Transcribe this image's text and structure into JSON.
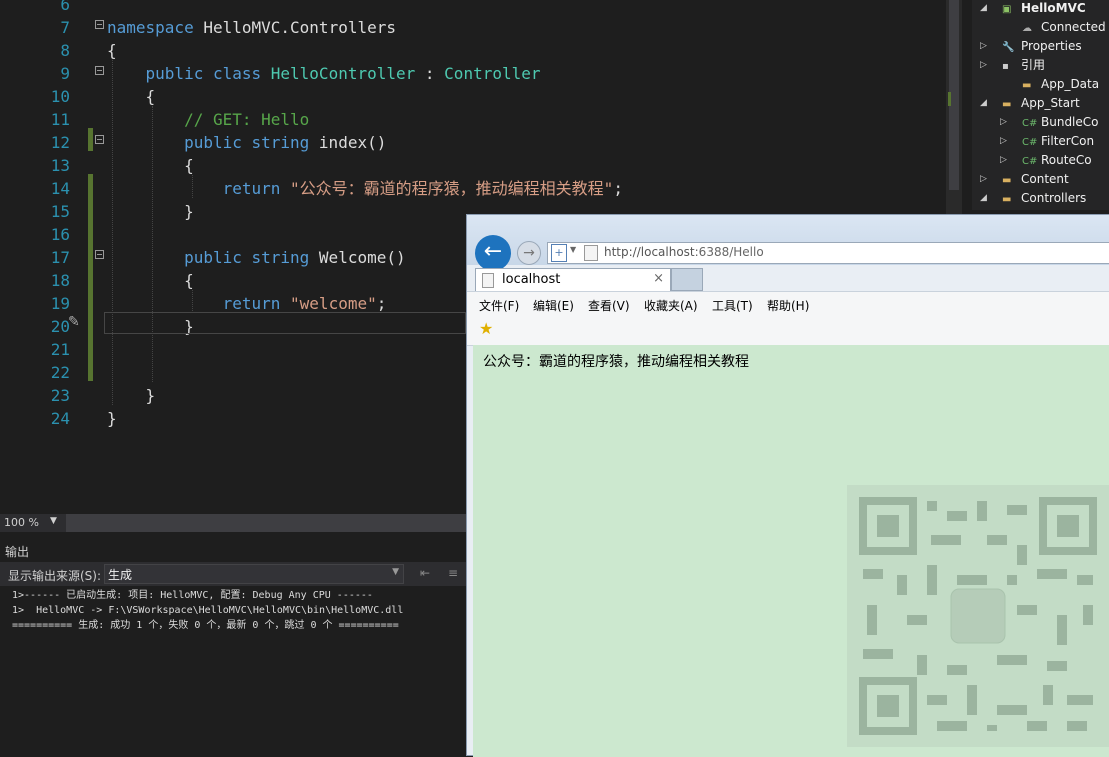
{
  "editor": {
    "lines": [
      {
        "num": "6",
        "tokens": []
      },
      {
        "num": "7",
        "tokens": [
          {
            "t": "namespace",
            "c": "kw"
          },
          {
            "t": " HelloMVC.Controllers",
            "c": ""
          }
        ]
      },
      {
        "num": "8",
        "tokens": [
          {
            "t": "{",
            "c": ""
          }
        ]
      },
      {
        "num": "9",
        "tokens": [
          {
            "t": "    public class ",
            "c": "kw"
          },
          {
            "t": "HelloController",
            "c": "type"
          },
          {
            "t": " : ",
            "c": ""
          },
          {
            "t": "Controller",
            "c": "type"
          }
        ]
      },
      {
        "num": "10",
        "tokens": [
          {
            "t": "    {",
            "c": ""
          }
        ]
      },
      {
        "num": "11",
        "tokens": [
          {
            "t": "        // GET: Hello",
            "c": "cmt"
          }
        ]
      },
      {
        "num": "12",
        "tokens": [
          {
            "t": "        public string ",
            "c": "kw"
          },
          {
            "t": "index()",
            "c": ""
          }
        ]
      },
      {
        "num": "13",
        "tokens": [
          {
            "t": "        {",
            "c": ""
          }
        ]
      },
      {
        "num": "14",
        "tokens": [
          {
            "t": "            return ",
            "c": "kw"
          },
          {
            "t": "\"公众号：霸道的程序猿，推动编程相关教程\"",
            "c": "str"
          },
          {
            "t": ";",
            "c": ""
          }
        ]
      },
      {
        "num": "15",
        "tokens": [
          {
            "t": "        }",
            "c": ""
          }
        ]
      },
      {
        "num": "16",
        "tokens": []
      },
      {
        "num": "17",
        "tokens": [
          {
            "t": "        public string ",
            "c": "kw"
          },
          {
            "t": "Welcome()",
            "c": ""
          }
        ]
      },
      {
        "num": "18",
        "tokens": [
          {
            "t": "        {",
            "c": ""
          }
        ]
      },
      {
        "num": "19",
        "tokens": [
          {
            "t": "            return ",
            "c": "kw"
          },
          {
            "t": "\"welcome\"",
            "c": "str"
          },
          {
            "t": ";",
            "c": ""
          }
        ]
      },
      {
        "num": "20",
        "tokens": [
          {
            "t": "        }",
            "c": ""
          }
        ]
      },
      {
        "num": "21",
        "tokens": []
      },
      {
        "num": "22",
        "tokens": []
      },
      {
        "num": "23",
        "tokens": [
          {
            "t": "    }",
            "c": ""
          }
        ]
      },
      {
        "num": "24",
        "tokens": [
          {
            "t": "}",
            "c": ""
          }
        ]
      }
    ]
  },
  "zoom": "100 %",
  "output": {
    "title": "输出",
    "source_label": "显示输出来源(S):",
    "source_value": "生成",
    "lines": [
      "1>------ 已启动生成: 项目: HelloMVC, 配置: Debug Any CPU ------",
      "1>  HelloMVC -> F:\\VSWorkspace\\HelloMVC\\HelloMVC\\bin\\HelloMVC.dll",
      "========== 生成: 成功 1 个，失败 0 个，最新 0 个，跳过 0 个 =========="
    ]
  },
  "solution": {
    "items": [
      {
        "label": "HelloMVC",
        "icon": "project-icon",
        "bold": true
      },
      {
        "label": "Connected S",
        "icon": "connected-icon"
      },
      {
        "label": "Properties",
        "icon": "wrench-icon"
      },
      {
        "label": "引用",
        "icon": "references-icon"
      },
      {
        "label": "App_Data",
        "icon": "folder-icon"
      },
      {
        "label": "App_Start",
        "icon": "folder-icon"
      },
      {
        "label": "BundleCo",
        "icon": "csharp-icon"
      },
      {
        "label": "FilterCon",
        "icon": "csharp-icon"
      },
      {
        "label": "RouteCo",
        "icon": "csharp-icon"
      },
      {
        "label": "Content",
        "icon": "folder-icon"
      },
      {
        "label": "Controllers",
        "icon": "folder-icon"
      }
    ]
  },
  "browser": {
    "url_host": "http://localhost",
    "url_rest": ":6388/Hello",
    "tab_title": "localhost",
    "menu": [
      "文件(F)",
      "编辑(E)",
      "查看(V)",
      "收藏夹(A)",
      "工具(T)",
      "帮助(H)"
    ],
    "content": "公众号：霸道的程序猿，推动编程相关教程"
  },
  "colors": {
    "editor_bg": "#1e1e1e",
    "keyword": "#569cd6",
    "type": "#4ec9b0",
    "string": "#d69d85",
    "comment": "#57a64a",
    "line_number": "#2b91af",
    "page_bg": "#cce8cf"
  }
}
